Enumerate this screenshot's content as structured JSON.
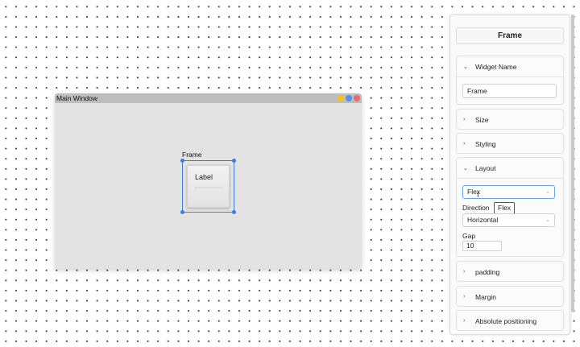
{
  "canvas": {
    "window": {
      "title": "Main Window",
      "controls": [
        {
          "name": "minimize-button",
          "color": "#f2c21b"
        },
        {
          "name": "maximize-button",
          "color": "#5b8ee6"
        },
        {
          "name": "close-button",
          "color": "#e86a6a"
        }
      ]
    },
    "frame": {
      "label": "Frame",
      "child_label": "Label"
    }
  },
  "panel": {
    "title": "Frame",
    "sections": {
      "widget_name": {
        "label": "Widget Name",
        "value": "Frame"
      },
      "size": {
        "label": "Size"
      },
      "styling": {
        "label": "Styling"
      },
      "layout": {
        "label": "Layout",
        "layout_value": "Flex",
        "tooltip": "Flex",
        "direction_label": "Direction",
        "direction_value": "Horizontal",
        "gap_label": "Gap",
        "gap_value": "10"
      },
      "padding": {
        "label": "padding"
      },
      "margin": {
        "label": "Margin"
      },
      "absolute": {
        "label": "Absolute positioning"
      }
    }
  },
  "icons": {
    "chevron_down": "⌄",
    "chevron_right": "›",
    "text_cursor": "I"
  },
  "colors": {
    "selection": "#3b7ddd"
  }
}
